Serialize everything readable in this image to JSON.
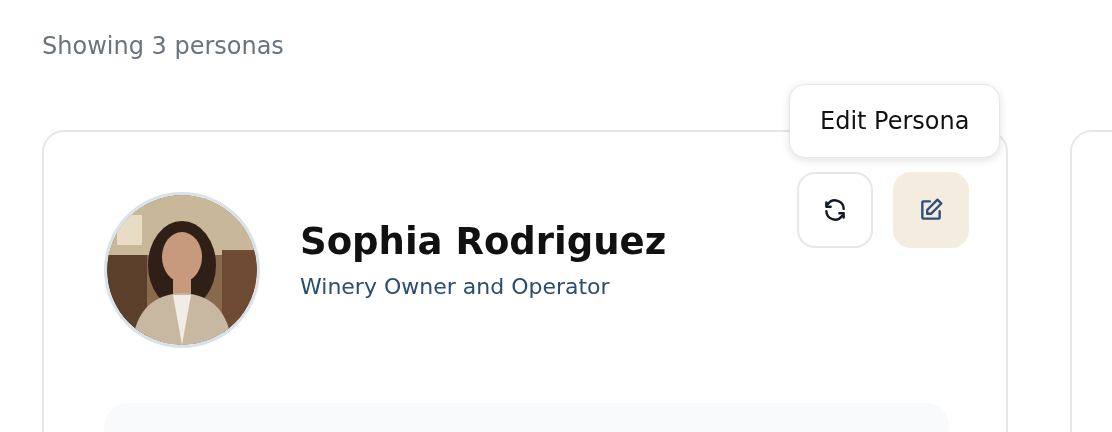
{
  "summary": "Showing 3 personas",
  "persona": {
    "name": "Sophia Rodriguez",
    "role": "Winery Owner and Operator",
    "actions": [
      {
        "kind": "refresh",
        "hovered": false
      },
      {
        "kind": "edit",
        "hovered": true,
        "tooltip": "Edit Persona"
      }
    ]
  }
}
